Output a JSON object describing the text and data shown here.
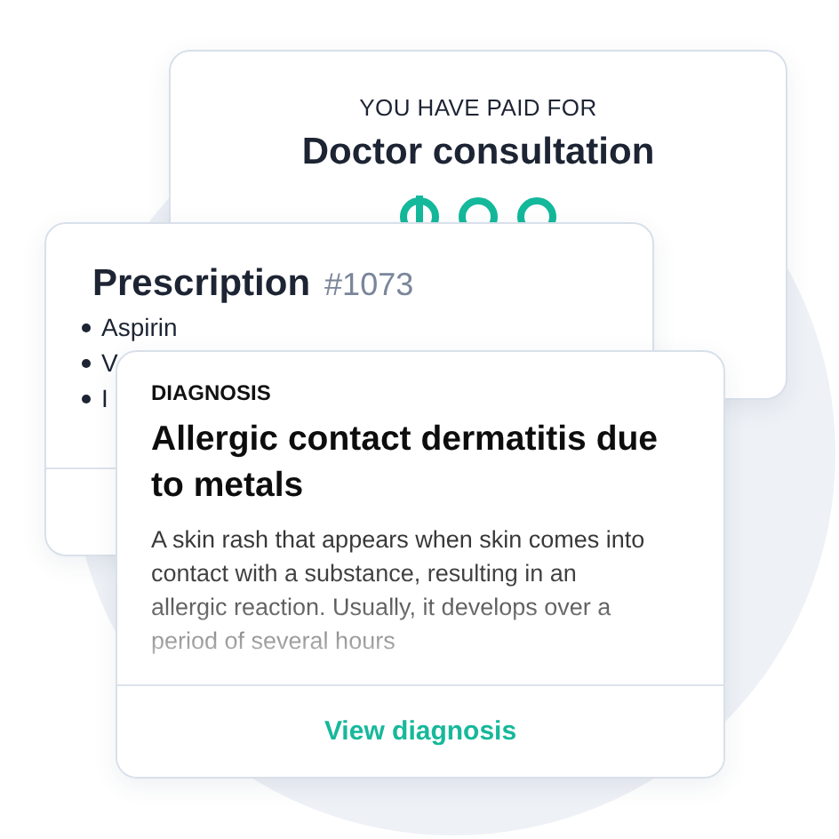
{
  "payment_card": {
    "eyebrow": "YOU HAVE PAID FOR",
    "title": "Doctor consultation"
  },
  "prescription_card": {
    "title": "Prescription",
    "number": "#1073",
    "items": [
      "Aspirin",
      "V",
      "I"
    ]
  },
  "diagnosis_card": {
    "eyebrow": "DIAGNOSIS",
    "title": "Allergic contact dermatitis due to metals",
    "description": "A skin rash that appears when skin comes into contact with a substance, resulting in an allergic reaction. Usually, it develops over a period of several hours",
    "action": "View diagnosis"
  }
}
